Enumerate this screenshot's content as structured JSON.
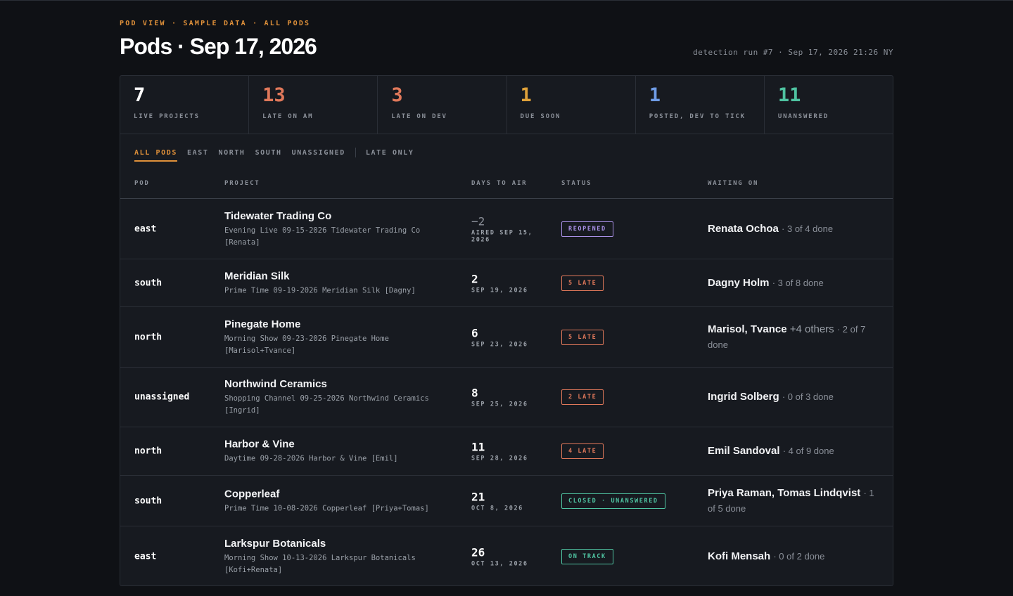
{
  "header": {
    "eyebrow": "POD VIEW · SAMPLE DATA · ALL PODS",
    "title": "Pods · Sep 17, 2026",
    "run_info": "detection run #7 · Sep 17, 2026 21:26 NY"
  },
  "stats": [
    {
      "value": "7",
      "label": "LIVE PROJECTS",
      "color": "#ffffff"
    },
    {
      "value": "13",
      "label": "LATE ON AM",
      "color": "#e0785a"
    },
    {
      "value": "3",
      "label": "LATE ON DEV",
      "color": "#e0785a"
    },
    {
      "value": "1",
      "label": "DUE SOON",
      "color": "#e0a23a"
    },
    {
      "value": "1",
      "label": "POSTED, DEV TO TICK",
      "color": "#6f9ce6"
    },
    {
      "value": "11",
      "label": "UNANSWERED",
      "color": "#4fc3a1"
    }
  ],
  "tabs": {
    "all": "ALL PODS",
    "east": "EAST",
    "north": "NORTH",
    "south": "SOUTH",
    "unassigned": "UNASSIGNED",
    "late_only": "LATE ONLY"
  },
  "table": {
    "headers": {
      "pod": "POD",
      "project": "PROJECT",
      "days": "DAYS TO AIR",
      "status": "STATUS",
      "waiting": "WAITING ON"
    },
    "rows": [
      {
        "pod": "east",
        "name": "Tidewater Trading Co",
        "desc": "Evening Live 09-15-2026 Tidewater Trading Co [Renata]",
        "days": "−2",
        "date": "AIRED SEP 15, 2026",
        "status": "REOPENED",
        "status_kind": "reopened",
        "who": "Renata Ochoa",
        "more": "",
        "progress": "· 3 of 4 done"
      },
      {
        "pod": "south",
        "name": "Meridian Silk",
        "desc": "Prime Time 09-19-2026 Meridian Silk [Dagny]",
        "days": "2",
        "date": "SEP 19, 2026",
        "status": "5 LATE",
        "status_kind": "late",
        "who": "Dagny Holm",
        "more": "",
        "progress": "· 3 of 8 done"
      },
      {
        "pod": "north",
        "name": "Pinegate Home",
        "desc": "Morning Show 09-23-2026 Pinegate Home [Marisol+Tvance]",
        "days": "6",
        "date": "SEP 23, 2026",
        "status": "5 LATE",
        "status_kind": "late",
        "who": "Marisol, Tvance",
        "more": "+4 others",
        "progress": "· 2 of 7 done"
      },
      {
        "pod": "unassigned",
        "name": "Northwind Ceramics",
        "desc": "Shopping Channel 09-25-2026 Northwind Ceramics [Ingrid]",
        "days": "8",
        "date": "SEP 25, 2026",
        "status": "2 LATE",
        "status_kind": "late",
        "who": "Ingrid Solberg",
        "more": "",
        "progress": "· 0 of 3 done"
      },
      {
        "pod": "north",
        "name": "Harbor & Vine",
        "desc": "Daytime 09-28-2026 Harbor & Vine [Emil]",
        "days": "11",
        "date": "SEP 28, 2026",
        "status": "4 LATE",
        "status_kind": "late",
        "who": "Emil Sandoval",
        "more": "",
        "progress": "· 4 of 9 done"
      },
      {
        "pod": "south",
        "name": "Copperleaf",
        "desc": "Prime Time 10-08-2026 Copperleaf [Priya+Tomas]",
        "days": "21",
        "date": "OCT 8, 2026",
        "status": "CLOSED · UNANSWERED",
        "status_kind": "closed",
        "who": "Priya Raman, Tomas Lindqvist",
        "more": "",
        "progress": "· 1 of 5 done"
      },
      {
        "pod": "east",
        "name": "Larkspur Botanicals",
        "desc": "Morning Show 10-13-2026 Larkspur Botanicals [Kofi+Renata]",
        "days": "26",
        "date": "OCT 13, 2026",
        "status": "ON TRACK",
        "status_kind": "ontrack",
        "who": "Kofi Mensah",
        "more": "",
        "progress": "· 0 of 2 done"
      }
    ]
  },
  "status_colors": {
    "reopened": "#a990e6",
    "late": "#e0785a",
    "closed": "#4fc3a1",
    "ontrack": "#4fc3a1"
  }
}
